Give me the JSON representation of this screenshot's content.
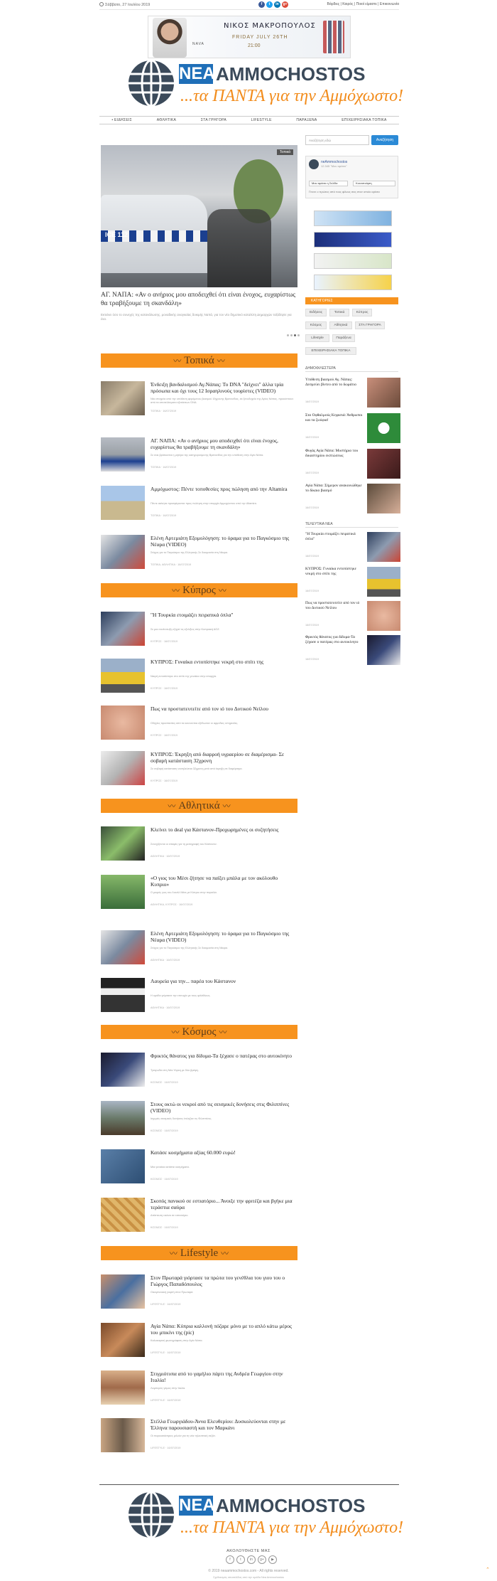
{
  "topbar": {
    "date": "Σάββατο, 27 Ιουλίου 2019",
    "links": "Βάρδιες | Καιρός | Ποιοί είμαστε | Επικοινωνία",
    "socials": [
      "f",
      "t",
      "in",
      "g+"
    ]
  },
  "ad": {
    "artist": "ΝΙΚΟΣ ΜΑΚΡΟΠΟΥΛΟΣ",
    "date": "FRIDAY JULY 26TH",
    "time": "21:00",
    "brand": "NAVA"
  },
  "logo": {
    "nea": "NEA",
    "ammochostos": "AMMOCHOSTOS",
    "tagline": "...τα ΠΑΝΤΑ για την Αμμόχωστο!"
  },
  "nav": [
    "• ΕΙΔΗΣΕΙΣ",
    "ΑΘΛΗΤΙΚΑ",
    "ΣΤΑ ΓΡΗΓΟΡΑ",
    "LIFESTYLE",
    "ΠΑΡΑΞΕΝΑ",
    "ΕΠΙΧΕΙΡΗΣΙΑΚΑ ΤΟΠΙΚΑ"
  ],
  "hero": {
    "tag": "Τοπικά",
    "title": "ΑΓ. ΝΑΠΑ: «Αν ο ανήριος μου αποδειχθεί ότι είναι ένοχος, ευχαρίστως θα τραβήξουμε τη σκανδάλη»",
    "excerpt": "Εκτείνει όσο το συνεχές της κατανάλωσης, μοναδικής αναγκαίας δοκιμής Ναπά, για τον νέο δημοτικό καταλύτη Δημαρχών ταξιδέψτε για ένα."
  },
  "sections": {
    "topika": "Τοπικά",
    "kypros": "Κύπρος",
    "athlitika": "Αθλητικά",
    "kosmos": "Κόσμος",
    "lifestyle": "Lifestyle"
  },
  "articles": [
    {
      "title": "Ένδειξη βανδαλισμού Αγ.Νάπας: Το DNA \"δείχνει\" άλλα τρία πρόσωπα και όχι τους 12 Ισραηλινούς τουρίστες (VIDEO)",
      "excerpt": "Νέα στοιχεία από την υπόθεση φερόμενου βιασμού 19χρονης Βρετανίδας, σε ξενοδοχείο της Αγίας Νάπας, προκύπτουν από τα αποτελέσματα εξετάσεων DNA.",
      "meta": "ΤΟΠΙΚΑ · 16/07/2019"
    },
    {
      "title": "ΑΓ. ΝΑΠΑ: «Αν ο ανήριος μου αποδειχθεί ότι είναι ένοχος, ευχαρίστως θα τραβήξουμε τη σκανδάλη»",
      "excerpt": "Σε σοκ βρίσκονται η μητέρα της κατηγορούμενης Βρετανίδας για την υπόθεση στην Αγία Νάπα.",
      "meta": "ΤΟΠΙΚΑ · 16/07/2019"
    },
    {
      "title": "Αμμόχωστος: Πέντε τοποθεσίες πρoς πώληση από την Altamira",
      "excerpt": "Πέντε ακίνητα προσφέρονται προς πώληση στην επαρχία Αμμοχώστου από την Altamira.",
      "meta": "ΤΟΠΙΚΑ · 16/07/2019"
    },
    {
      "title": "Ελένη Αρτεμιάτη Εξομολόγηση: το όραμα για το Παγκόσμιο της Νέαρα (VIDEO)",
      "excerpt": "Στόχος για το Παγκόσμιο της Ελληνικής Σε δοκιμασία στη Νέαρα.",
      "meta": "ΤΟΠΙΚΑ, ΑΘΛΗΤΙΚΑ · 16/07/2019"
    },
    {
      "title": "\"Η Τουρκία ετοιμάζει πειρατικά όπλα\"",
      "excerpt": "Σε μια συνέντευξη εξηγεί τις εξελίξεις στην Κυπριακή ΑΟΖ.",
      "meta": "ΚΥΠΡΟΣ · 16/07/2019"
    },
    {
      "title": "ΚΥΠΡΟΣ: Γυναίκα εντοπίστηκε νεκρή στο σπίτι της",
      "excerpt": "Νεκρή εντοπίστηκε στο σπίτι της γυναίκα στην επαρχία.",
      "meta": "ΚΥΠΡΟΣ · 16/07/2019"
    },
    {
      "title": "Πως να προστατευτείτε από τον ιό του Δυτικού Νείλου",
      "excerpt": "Οδηγίες προστασίας από τα κουνούπια εξέδωσαν οι αρμόδιες υπηρεσίες.",
      "meta": "ΚΥΠΡΟΣ · 16/07/2019"
    },
    {
      "title": "ΚΥΠΡΟΣ: Έκρηξη από διαρροή υγραερίου σε διαμέρισμα- Σε σοβαρή κατάσταση 32χρονη",
      "excerpt": "Σε σοβαρή κατάσταση νοσηλεύεται 32χρονη μετά από έκρηξη σε διαμέρισμα.",
      "meta": "ΚΥΠΡΟΣ · 16/07/2019"
    },
    {
      "title": "Κλείνει το deal για Κάστανον-Προχωρημένες οι συζητήσεις",
      "excerpt": "Συνεχίζονται οι επαφές για τη μεταγραφή του Κάστανον.",
      "meta": "ΑΘΛΗΤΙΚΑ · 16/07/2019"
    },
    {
      "title": "«Ο γιος του Μέσι ζήτησε να παίξει μπάλα με τον ακόλουθο Κυπριο»",
      "excerpt": "Ο μικρός γιος του Λιονέλ Μέσι με Κύπριο στην παραλία.",
      "meta": "ΑΘΛΗΤΙΚΑ, ΚΥΠΡΟΣ · 16/07/2019"
    },
    {
      "title": "Ελένη Αρτεμιάτη Εξομολόγηση: το όραμα για το Παγκόσμιο της Νέαρα (VIDEO)",
      "excerpt": "Στόχος για το Παγκόσμιο της Ελληνικής Σε δοκιμασία στη Νέαρα.",
      "meta": "ΑΘΛΗΤΙΚΑ · 16/07/2019"
    },
    {
      "title": "Λαυρεία για την... παρέα του Κάστανον",
      "excerpt": "Η ομάδα γιόρτασε την επιτυχία με τους φιλάθλους.",
      "meta": "ΑΘΛΗΤΙΚΑ · 16/07/2019"
    },
    {
      "title": "Φρικτός θάνατος για δίδυμα-Τα ξέχασε ο πατέρας στο αυτοκίνητο",
      "excerpt": "Τραγωδία στη Νέα Υόρκη με δύο βρέφη.",
      "meta": "ΚΟΣΜΟΣ · 16/07/2019"
    },
    {
      "title": "Στους οκτώ οι νεκροί από τις σεισμικές δονήσεις στις Φιλιππίνες (VIDEO)",
      "excerpt": "Ισχυρές σεισμικές δονήσεις έπληξαν τις Φιλιππίνες.",
      "meta": "ΚΟΣΜΟΣ · 16/07/2019"
    },
    {
      "title": "Κατάσε κοσμήματα αξίας 60.000 ευρώ!",
      "excerpt": "Μια γυναίκα κατάπιε κοσμήματα.",
      "meta": "ΚΟΣΜΟΣ · 16/07/2019"
    },
    {
      "title": "Σκοπός πανικού σε εστιατόριο... Άνοιξε την φριτέζα και βγήκε μια τεράστια σαύρα",
      "excerpt": "Απίστευτη εικόνα σε εστιατόριο.",
      "meta": "ΚΟΣΜΟΣ · 16/07/2019"
    },
    {
      "title": "Στον Πρωταρά γιόρτασε τα πρώτα του γενέθλια του γιου του ο Γιώργος Παπαδόπουλος",
      "excerpt": "Οικογενειακή γιορτή στον Πρωταρά.",
      "meta": "LIFESTYLE · 16/07/2019"
    },
    {
      "title": "Αγία Νάπα: Κύπρια καλλονή πόζαρε μόνο με το απλό κάτω μέρος του μπικίνι της (pic)",
      "excerpt": "Καλοκαιρινή φωτογράφιση στην Αγία Νάπα.",
      "meta": "LIFESTYLE · 16/07/2019"
    },
    {
      "title": "Στιγμιότυπα από το γαμήλιο πάρτι της Ανδρέα Γεωργίου στην Ιταλία!",
      "excerpt": "Λαμπερός γάμος στην Ιταλία.",
      "meta": "LIFESTYLE · 16/07/2019"
    },
    {
      "title": "Στέλλα Γεωργιάδου-Άννα Ελευθερίου: Δυσκολεύονται στην με Έλληνα παρουσιαστή και τον Μαρκάνι",
      "excerpt": "Οι παρουσιάστριες μιλούν για τη νέα τηλεοπτική σεζόν.",
      "meta": "LIFESTYLE · 16/07/2019"
    }
  ],
  "sidebar": {
    "search_placeholder": "Αναζήτηση εδώ",
    "search_button": "Αναζήτηση",
    "fb_name": "neAmmochostos",
    "fb_sub": "12.345 \"Μου αρέσει\"",
    "fb_like": "Μου αρέσει η Σελίδα",
    "fb_share": "Κοινοποίηση",
    "fb_desc": "Γίνετε ο πρώτος από τους φίλους σας στον οποίο αρέσει",
    "cat_head": "ΚΑΤΗΓΟΡΙΕΣ",
    "tags": [
      "Ειδήσεις",
      "Τοπικά",
      "Κύπρος",
      "Κόσμος",
      "Αθλητικά",
      "ΣΤΑ ΓΡΗΓΟΡΑ",
      "Lifestyle",
      "Παράξενα",
      "ΕΠΙΧΕΙΡΗΣΙΑΚΑ ΤΟΠΙΚΑ"
    ],
    "popular_head": "ΔΗΜΟΦΙΛΕΣΤΕΡΑ",
    "latest_head": "ΤΕΛΕΥΤΑΙΑ ΝΕΑ",
    "popular": [
      {
        "title": "Υπόθεση βιασμού Αγ. Νάπας: Δεσμεύει βίντεο από το δωμάτιο",
        "date": "16/07/2019"
      },
      {
        "title": "Στα Οφθαλμούς Κηφισιά: Άνθρωποι και τα ζωύφια!",
        "date": "16/07/2019"
      },
      {
        "title": "Φυγάς Αγία Νάπα: Μυστήριο του δικαστηρίου εκπτώσεως",
        "date": "16/07/2019"
      },
      {
        "title": "Αγία Νάπα: Σήμερον ανακοινώθηκε το δίκαιο βιασμό",
        "date": "16/07/2019"
      }
    ],
    "latest": [
      {
        "title": "\"Η Τουρκία ετοιμάζει πειρατικά όπλα\"",
        "date": "16/07/2019"
      },
      {
        "title": "ΚΥΠΡΟΣ: Γυναίκα εντοπίστηκε νεκρή στο σπίτι της",
        "date": "16/07/2019"
      },
      {
        "title": "Πως να προστατευτείτε από τον ιό του Δυτικού Νείλου",
        "date": "16/07/2019"
      },
      {
        "title": "Φρικτός θάνατος για δίδυμα-Τα ξέχασε ο πατέρας στο αυτοκίνητο",
        "date": "16/07/2019"
      }
    ]
  },
  "footer": {
    "follow": "ΑΚΟΛΟΥΘΗΣΤΕ ΜΑΣ",
    "socials": [
      "f",
      "t",
      "in",
      "g+",
      "▶"
    ],
    "copyright": "© 2019 neaammochostos.com - All rights reserved.",
    "credit": "Σχεδιασμός ιστοσελίδας από την ομάδα Nea Ammochostos"
  }
}
